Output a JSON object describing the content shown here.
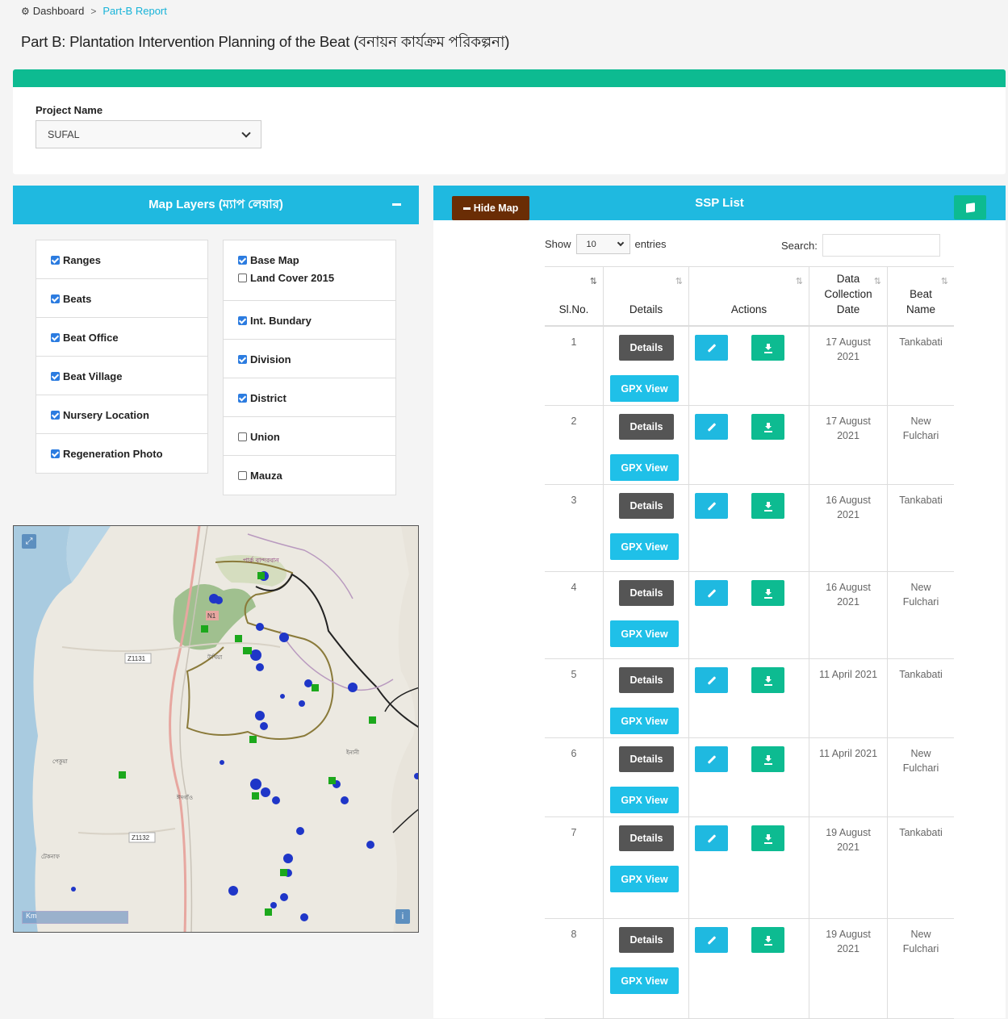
{
  "breadcrumb": {
    "home_label": "Dashboard",
    "separator": ">",
    "current": "Part-B Report"
  },
  "page": {
    "title": "Part B: Plantation Intervention Planning of the Beat (বনায়ন কার্যক্রম পরিকল্পনা)"
  },
  "project": {
    "label": "Project Name",
    "selected": "SUFAL"
  },
  "map_layers": {
    "title": "Map Layers (ম্যাপ লেয়ার)",
    "left_items": [
      {
        "label": "Ranges",
        "checked": true
      },
      {
        "label": "Beats",
        "checked": true
      },
      {
        "label": "Beat Office",
        "checked": true
      },
      {
        "label": "Beat Village",
        "checked": true
      },
      {
        "label": "Nursery Location",
        "checked": true
      },
      {
        "label": "Regeneration Photo",
        "checked": true
      }
    ],
    "right_items": [
      {
        "label": "Base Map",
        "checked": true
      },
      {
        "label": "Land Cover 2015",
        "checked": false
      },
      {
        "label": "Int. Bundary",
        "checked": true
      },
      {
        "label": "Division",
        "checked": true
      },
      {
        "label": "District",
        "checked": true
      },
      {
        "label": "Union",
        "checked": false
      },
      {
        "label": "Mauza",
        "checked": false
      }
    ]
  },
  "map": {
    "labels": [
      "পার্ক বান্দরবান",
      "N1",
      "Z1131",
      "Z1132",
      "ইনানী",
      "পেকুয়া",
      "উখিয়া",
      "টেকনাফ",
      "ঈদগাঁও",
      "Km"
    ]
  },
  "ssp": {
    "title": "SSP List",
    "hide_map_label": "Hide Map",
    "show_label": "Show",
    "entries_value": "10",
    "entries_label": "entries",
    "search_label": "Search:",
    "columns": [
      {
        "line1": "",
        "line2": "",
        "line3": "Sl.No."
      },
      {
        "line1": "",
        "line2": "",
        "line3": "Details"
      },
      {
        "line1": "",
        "line2": "",
        "line3": "Actions"
      },
      {
        "line1": "Data",
        "line2": "Collection",
        "line3": "Date"
      },
      {
        "line1": "",
        "line2": "Beat",
        "line3": "Name"
      }
    ],
    "details_label": "Details",
    "gpx_label": "GPX View",
    "rows": [
      {
        "sl": "1",
        "date_line1": "17 August",
        "date_line2": "2021",
        "beat_line1": "Tankabati",
        "beat_line2": ""
      },
      {
        "sl": "2",
        "date_line1": "17 August",
        "date_line2": "2021",
        "beat_line1": "New",
        "beat_line2": "Fulchari"
      },
      {
        "sl": "3",
        "date_line1": "16 August",
        "date_line2": "2021",
        "beat_line1": "Tankabati",
        "beat_line2": ""
      },
      {
        "sl": "4",
        "date_line1": "16 August",
        "date_line2": "2021",
        "beat_line1": "New",
        "beat_line2": "Fulchari"
      },
      {
        "sl": "5",
        "date_line1": "11 April 2021",
        "date_line2": "",
        "beat_line1": "Tankabati",
        "beat_line2": ""
      },
      {
        "sl": "6",
        "date_line1": "11 April 2021",
        "date_line2": "",
        "beat_line1": "New",
        "beat_line2": "Fulchari"
      },
      {
        "sl": "7",
        "date_line1": "19 August",
        "date_line2": "2021",
        "beat_line1": "Tankabati",
        "beat_line2": ""
      },
      {
        "sl": "8",
        "date_line1": "19 August",
        "date_line2": "2021",
        "beat_line1": "New",
        "beat_line2": "Fulchari"
      }
    ]
  },
  "colors": {
    "accent": "#1fb9e0",
    "green": "#0dbb91",
    "hide_map": "#6a2d05",
    "dark_button": "#555555"
  }
}
